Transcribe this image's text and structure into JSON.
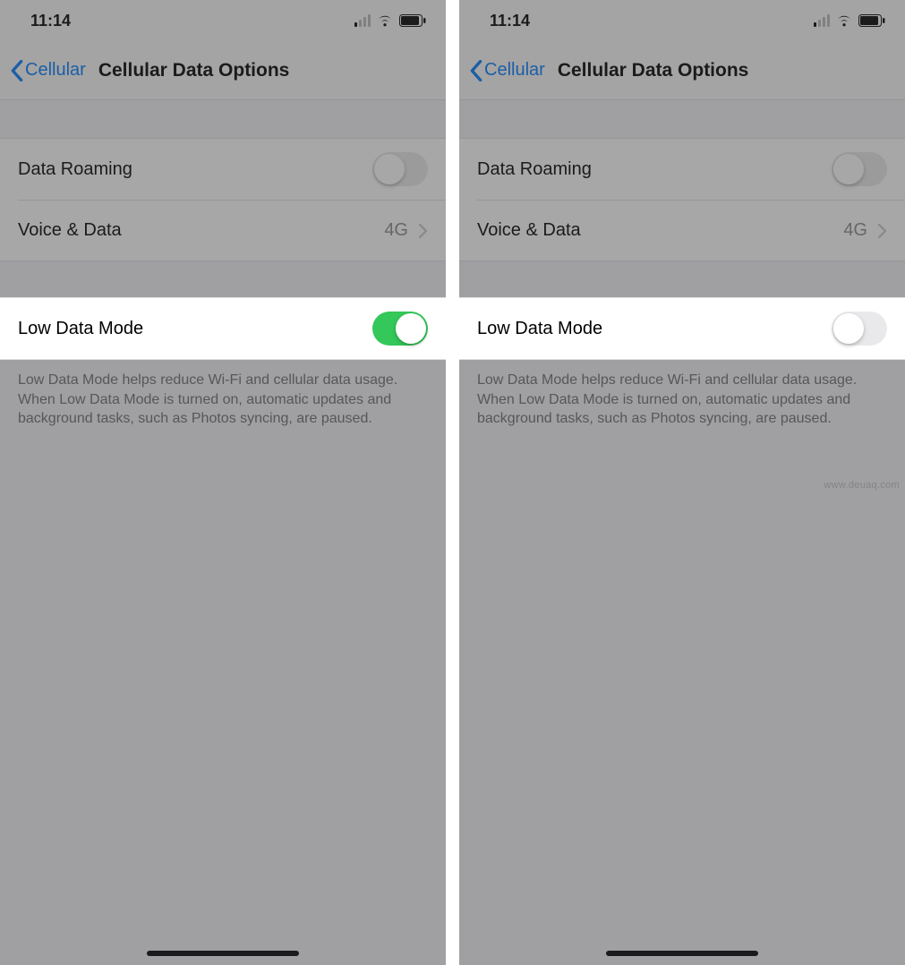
{
  "screens": [
    {
      "status_time": "11:14",
      "nav_back": "Cellular",
      "nav_title": "Cellular Data Options",
      "rows": {
        "data_roaming": {
          "label": "Data Roaming",
          "on": false
        },
        "voice_data": {
          "label": "Voice & Data",
          "value": "4G"
        },
        "low_data_mode": {
          "label": "Low Data Mode",
          "on": true
        }
      },
      "footer": "Low Data Mode helps reduce Wi-Fi and cellular data usage. When Low Data Mode is turned on, automatic updates and background tasks, such as Photos syncing, are paused."
    },
    {
      "status_time": "11:14",
      "nav_back": "Cellular",
      "nav_title": "Cellular Data Options",
      "rows": {
        "data_roaming": {
          "label": "Data Roaming",
          "on": false
        },
        "voice_data": {
          "label": "Voice & Data",
          "value": "4G"
        },
        "low_data_mode": {
          "label": "Low Data Mode",
          "on": false
        }
      },
      "footer": "Low Data Mode helps reduce Wi-Fi and cellular data usage. When Low Data Mode is turned on, automatic updates and background tasks, such as Photos syncing, are paused."
    }
  ],
  "watermark": "www.deuaq.com"
}
